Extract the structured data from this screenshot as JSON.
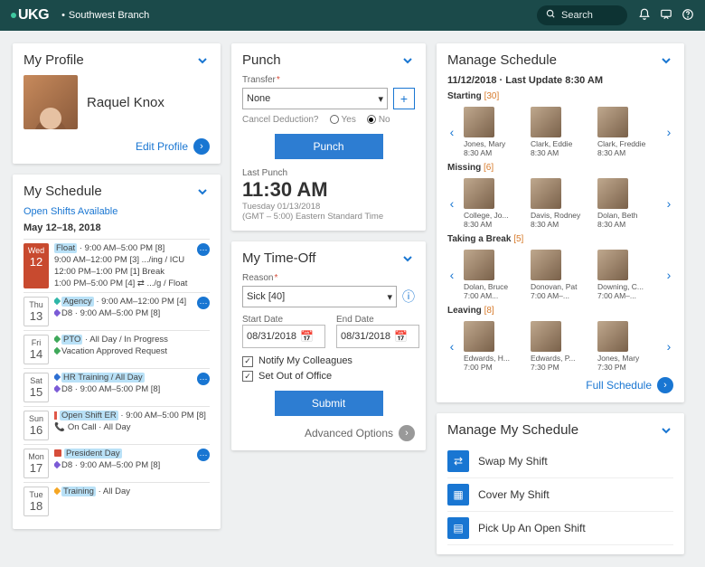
{
  "topbar": {
    "logo": "UKG",
    "branch": "Southwest Branch",
    "search_placeholder": "Search"
  },
  "profile": {
    "title": "My Profile",
    "name": "Raquel Knox",
    "edit": "Edit Profile"
  },
  "schedule": {
    "title": "My Schedule",
    "open_shifts": "Open Shifts Available",
    "range": "May 12–18, 2018",
    "days": [
      {
        "dow": "Wed",
        "dnum": "12",
        "style": "red",
        "lines": [
          "Float · 9:00 AM–5:00 PM [8]",
          "9:00 AM–12:00 PM [3] .../ing / ICU",
          "12:00 PM–1:00 PM [1]  Break",
          "1:00 PM–5:00 PM [4] ⇄ .../g / Float"
        ],
        "dots": true
      },
      {
        "dow": "Thu",
        "dnum": "13",
        "style": "gray",
        "lines": [
          "Agency · 9:00 AM–12:00 PM [4]",
          "D8 · 9:00 AM–5:00 PM [8]"
        ],
        "dots": true,
        "icons": [
          "teal",
          "purple"
        ]
      },
      {
        "dow": "Fri",
        "dnum": "14",
        "style": "gray",
        "lines": [
          "PTO · All Day / In Progress",
          "Vacation Approved Request"
        ],
        "icons": [
          "green",
          "green"
        ]
      },
      {
        "dow": "Sat",
        "dnum": "15",
        "style": "gray",
        "lines": [
          "HR Training / All Day",
          "D8 · 9:00 AM–5:00 PM [8]"
        ],
        "dots": true,
        "icons": [
          "blue",
          "purple"
        ]
      },
      {
        "dow": "Sun",
        "dnum": "16",
        "style": "gray",
        "lines": [
          "Open Shift ER · 9:00 AM–5:00 PM [8]",
          "On Call · All Day"
        ],
        "icons": [
          "barred",
          "phone"
        ]
      },
      {
        "dow": "Mon",
        "dnum": "17",
        "style": "gray",
        "lines": [
          "President Day",
          "D8 · 9:00 AM–5:00 PM [8]"
        ],
        "dots": true,
        "icons": [
          "flag",
          "purple"
        ]
      },
      {
        "dow": "Tue",
        "dnum": "18",
        "style": "gray",
        "lines": [
          "Training · All Day"
        ],
        "icons": [
          "orange"
        ]
      }
    ]
  },
  "punch": {
    "title": "Punch",
    "transfer_label": "Transfer",
    "transfer_value": "None",
    "cancel_label": "Cancel Deduction?",
    "yes": "Yes",
    "no": "No",
    "button": "Punch",
    "last_label": "Last Punch",
    "time": "11:30 AM",
    "date": "Tuesday 01/13/2018",
    "tz": "(GMT – 5:00) Eastern Standard Time"
  },
  "timeoff": {
    "title": "My Time-Off",
    "reason_label": "Reason",
    "reason_value": "Sick [40]",
    "start_label": "Start Date",
    "start_value": "08/31/2018",
    "end_label": "End Date",
    "end_value": "08/31/2018",
    "notify": "Notify My Colleagues",
    "ooo": "Set Out of Office",
    "submit": "Submit",
    "advanced": "Advanced Options"
  },
  "manage": {
    "title": "Manage Schedule",
    "subtitle": "11/12/2018 · Last Update 8:30 AM",
    "sections": [
      {
        "label": "Starting",
        "count": "[30]",
        "emps": [
          {
            "n": "Jones, Mary",
            "t": "8:30 AM"
          },
          {
            "n": "Clark, Eddie",
            "t": "8:30 AM"
          },
          {
            "n": "Clark, Freddie",
            "t": "8:30 AM"
          }
        ]
      },
      {
        "label": "Missing",
        "count": "[6]",
        "emps": [
          {
            "n": "College, Jo...",
            "t": "8:30 AM"
          },
          {
            "n": "Davis, Rodney",
            "t": "8:30 AM"
          },
          {
            "n": "Dolan, Beth",
            "t": "8:30 AM"
          }
        ]
      },
      {
        "label": "Taking a Break",
        "count": "[5]",
        "emps": [
          {
            "n": "Dolan, Bruce",
            "t": "7:00 AM..."
          },
          {
            "n": "Donovan, Pat",
            "t": "7:00 AM–..."
          },
          {
            "n": "Downing, C...",
            "t": "7:00 AM–..."
          }
        ]
      },
      {
        "label": "Leaving",
        "count": "[8]",
        "emps": [
          {
            "n": "Edwards, H...",
            "t": "7:00 PM"
          },
          {
            "n": "Edwards, P...",
            "t": "7:30 PM"
          },
          {
            "n": "Jones, Mary",
            "t": "7:30 PM"
          }
        ]
      }
    ],
    "full": "Full Schedule"
  },
  "mms": {
    "title": "Manage My Schedule",
    "items": [
      "Swap My Shift",
      "Cover My Shift",
      "Pick Up An Open Shift"
    ]
  }
}
